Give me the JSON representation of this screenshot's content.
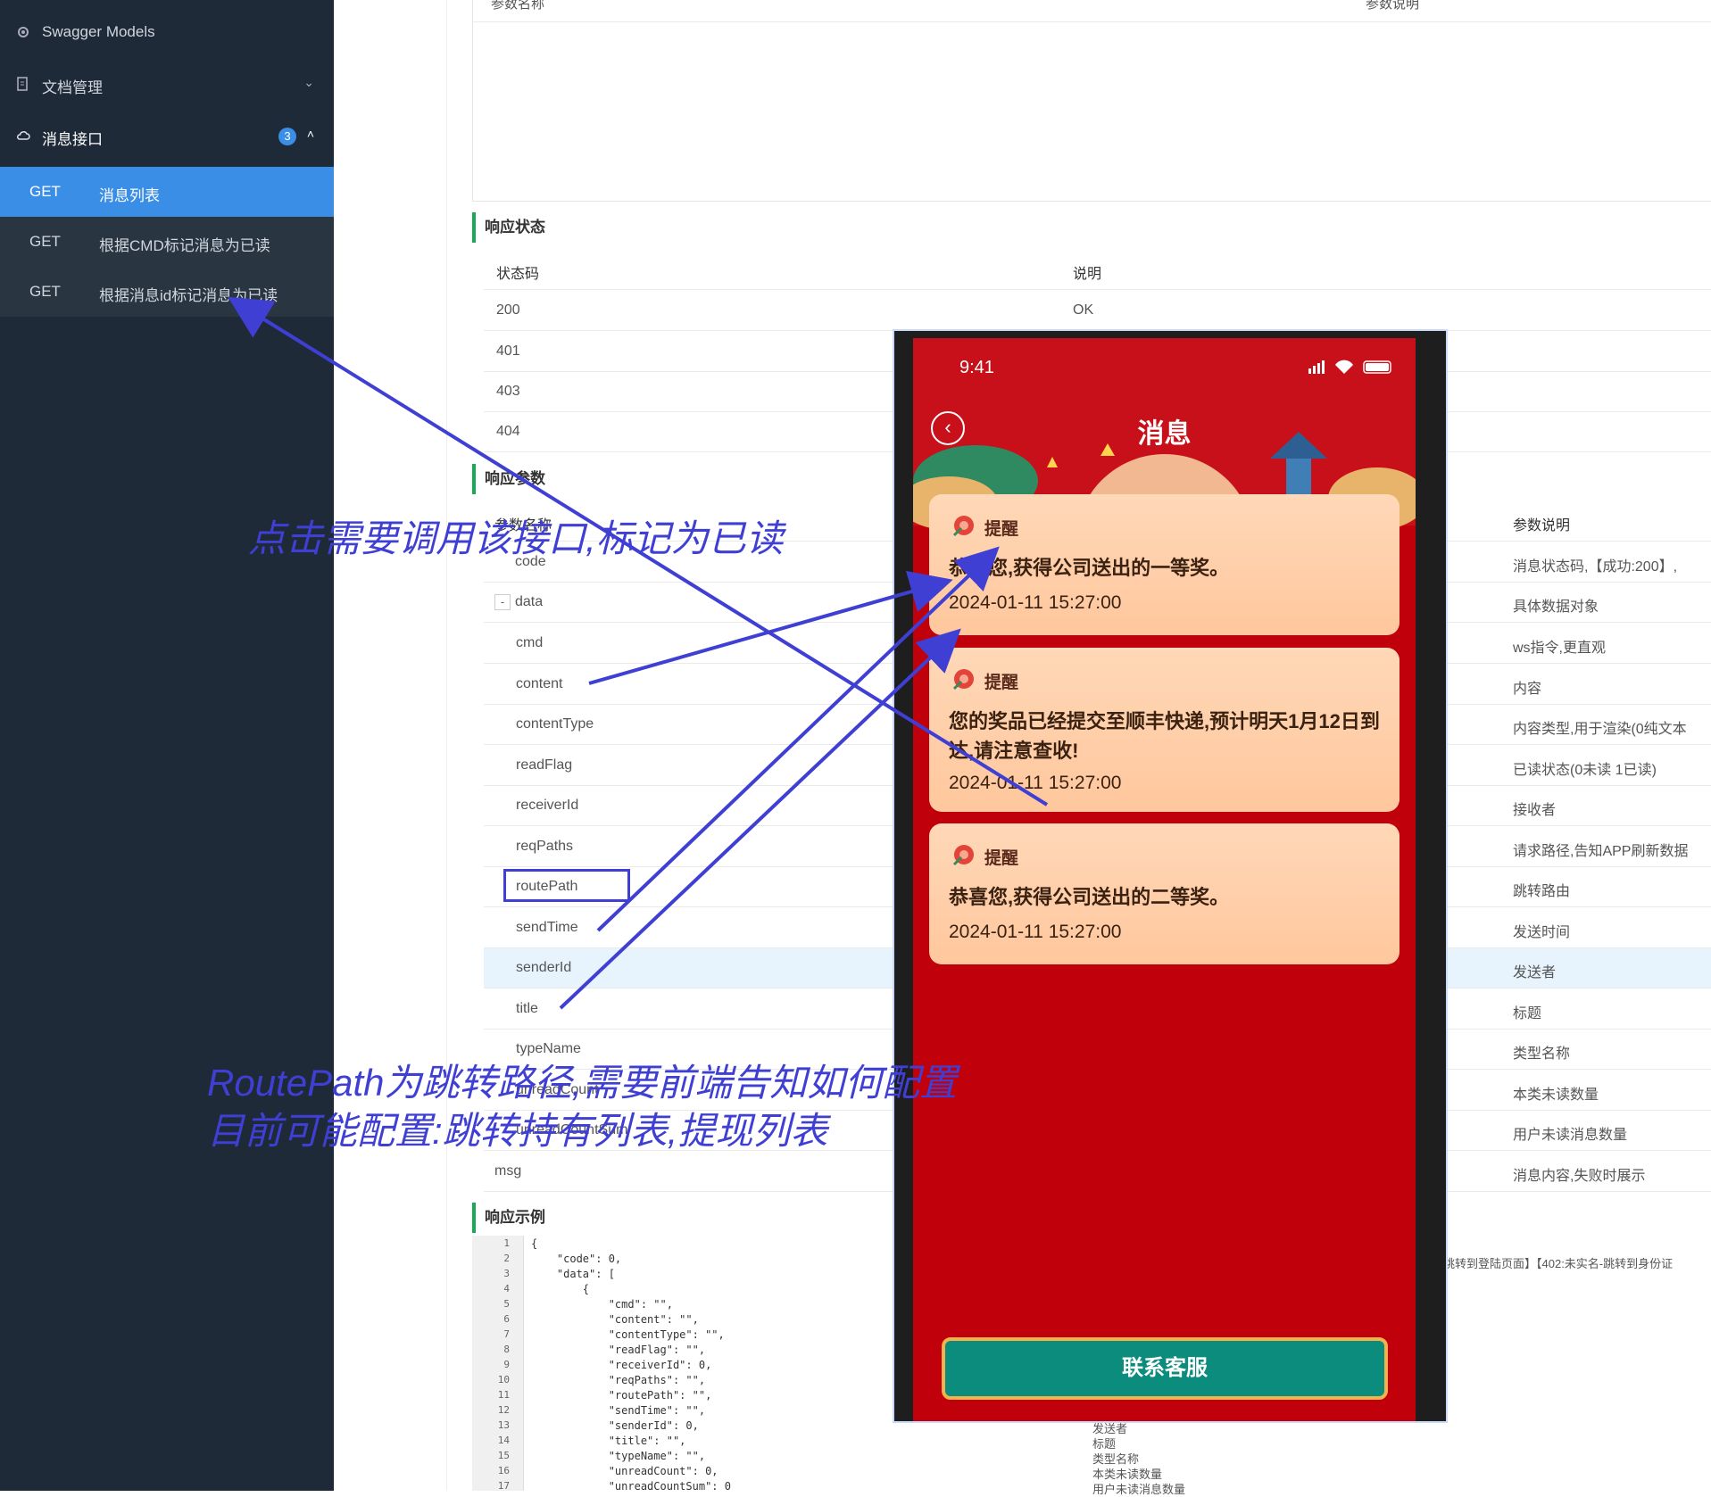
{
  "sidebar": {
    "items": [
      {
        "label": "Swagger Models",
        "icon": "gear-icon"
      },
      {
        "label": "文档管理",
        "icon": "document-icon"
      },
      {
        "label": "消息接口",
        "icon": "cloud-icon",
        "badge": "3"
      }
    ],
    "sub_items": [
      {
        "method": "GET",
        "label": "消息列表",
        "active": true
      },
      {
        "method": "GET",
        "label": "根据CMD标记消息为已读"
      },
      {
        "method": "GET",
        "label": "根据消息id标记消息为已读"
      }
    ]
  },
  "request_header": {
    "name": "参数名称",
    "desc": "参数说明"
  },
  "response_status": {
    "title": "响应状态",
    "headers": [
      "状态码",
      "说明"
    ],
    "rows": [
      {
        "code": "200",
        "desc": "OK"
      },
      {
        "code": "401",
        "desc": ""
      },
      {
        "code": "403",
        "desc": ""
      },
      {
        "code": "404",
        "desc": ""
      }
    ]
  },
  "response_params": {
    "title": "响应参数",
    "headers": [
      "参数名称",
      "参数说明"
    ],
    "rows": [
      {
        "name": "code",
        "desc": "消息状态码,【成功:200】,"
      },
      {
        "name": "data",
        "desc": "具体数据对象",
        "toggle": "-"
      },
      {
        "name": "cmd",
        "desc": "ws指令,更直观"
      },
      {
        "name": "content",
        "desc": "内容"
      },
      {
        "name": "contentType",
        "desc": "内容类型,用于渲染(0纯文本"
      },
      {
        "name": "readFlag",
        "desc": "已读状态(0未读 1已读)"
      },
      {
        "name": "receiverId",
        "desc": "接收者"
      },
      {
        "name": "reqPaths",
        "desc": "请求路径,告知APP刷新数据"
      },
      {
        "name": "routePath",
        "desc": "跳转路由"
      },
      {
        "name": "sendTime",
        "desc": "发送时间"
      },
      {
        "name": "senderId",
        "desc": "发送者"
      },
      {
        "name": "title",
        "desc": "标题"
      },
      {
        "name": "typeName",
        "desc": "类型名称"
      },
      {
        "name": "unreadCount",
        "desc": "本类未读数量"
      },
      {
        "name": "unreadCountSum",
        "desc": "用户未读消息数量"
      },
      {
        "name": "msg",
        "desc": "消息内容,失败时展示"
      }
    ]
  },
  "response_example": {
    "title": "响应示例",
    "lines": [
      "{",
      "    \"code\": 0,",
      "    \"data\": [",
      "        {",
      "            \"cmd\": \"\",",
      "            \"content\": \"\",",
      "            \"contentType\": \"\",",
      "            \"readFlag\": \"\",",
      "            \"receiverId\": 0,",
      "            \"reqPaths\": \"\",",
      "            \"routePath\": \"\",",
      "            \"sendTime\": \"\",",
      "            \"senderId\": 0,",
      "            \"title\": \"\",",
      "            \"typeName\": \"\",",
      "            \"unreadCount\": 0,",
      "            \"unreadCountSum\": 0"
    ],
    "side_note": "跳转到登陆页面】【402:未实名-跳转到身份证",
    "overflow_labels": [
      "发送者",
      "标题",
      "类型名称",
      "本类未读数量",
      "用户未读消息数量"
    ]
  },
  "phone": {
    "time": "9:41",
    "title": "消息",
    "messages": [
      {
        "tag": "提醒",
        "text": "恭喜您,获得公司送出的一等奖。",
        "time": "2024-01-11 15:27:00"
      },
      {
        "tag": "提醒",
        "text": "您的奖品已经提交至顺丰快递,预计明天1月12日到达,请注意查收!",
        "time": "2024-01-11 15:27:00"
      },
      {
        "tag": "提醒",
        "text": "恭喜您,获得公司送出的二等奖。",
        "time": "2024-01-11 15:27:00"
      }
    ],
    "contact_button": "联系客服"
  },
  "annotations": {
    "click_note": "点击需要调用该接口,标记为已读",
    "route_line1": "RoutePath为跳转路径,需要前端告知如何配置",
    "route_line2": "目前可能配置:跳转持有列表,提现列表"
  },
  "colors": {
    "accent": "#3a8ee6",
    "section_bar": "#1aaa55",
    "annotation": "#3f3fd4",
    "phone_bg": "#c0000b",
    "contact_btn": "#0b8c7c"
  }
}
